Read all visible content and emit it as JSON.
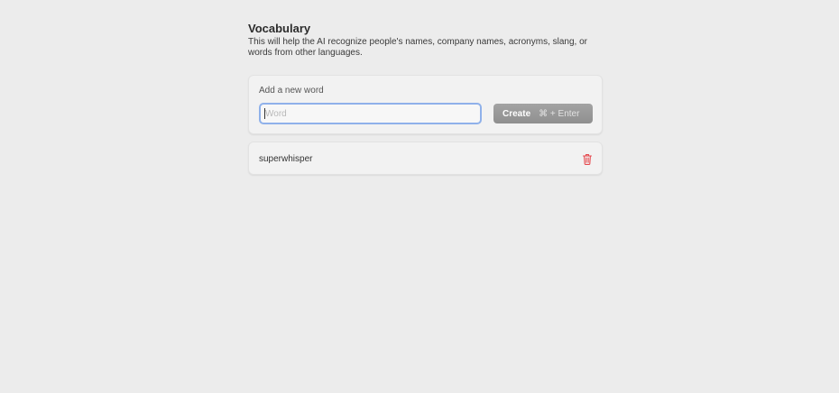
{
  "vocabulary": {
    "title": "Vocabulary",
    "description": "This will help the AI recognize people's names, company names, acronyms, slang, or words from other languages."
  },
  "add_word": {
    "label": "Add a new word",
    "input_value": "",
    "input_placeholder": "Word",
    "create_label": "Create",
    "create_shortcut": "⌘ + Enter"
  },
  "words": [
    {
      "text": "superwhisper",
      "delete_icon": "trash-icon"
    }
  ],
  "colors": {
    "background": "#ececec",
    "card": "#f2f2f2",
    "focus_ring": "#8fb1ea",
    "button": "#999999",
    "delete": "#e5484d"
  }
}
